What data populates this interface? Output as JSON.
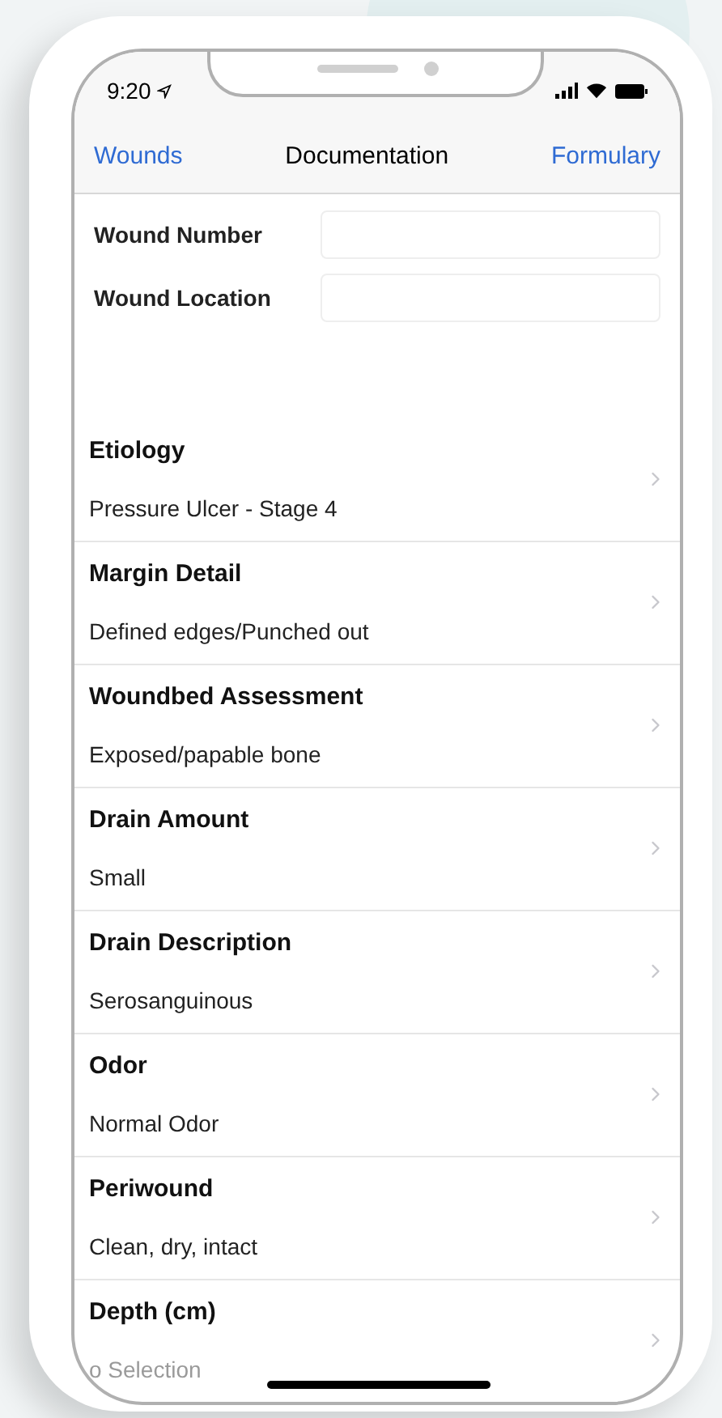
{
  "status_bar": {
    "time": "9:20"
  },
  "nav": {
    "back": "Wounds",
    "title": "Documentation",
    "action": "Formulary"
  },
  "fields": [
    {
      "label": "Wound Number"
    },
    {
      "label": "Wound Location"
    }
  ],
  "rows": [
    {
      "title": "Etiology",
      "value": "Pressure Ulcer - Stage 4",
      "kind": "value"
    },
    {
      "title": "Margin Detail",
      "value": "Defined edges/Punched out",
      "kind": "value"
    },
    {
      "title": "Woundbed Assessment",
      "value": "Exposed/papable bone",
      "kind": "value"
    },
    {
      "title": "Drain Amount",
      "value": "Small",
      "kind": "value"
    },
    {
      "title": "Drain Description",
      "value": "Serosanguinous",
      "kind": "value"
    },
    {
      "title": "Odor",
      "value": "Normal Odor",
      "kind": "value"
    },
    {
      "title": "Periwound",
      "value": "Clean, dry, intact",
      "kind": "value"
    },
    {
      "title": "Depth (cm)",
      "value": "o Selection",
      "kind": "placeholder"
    }
  ]
}
